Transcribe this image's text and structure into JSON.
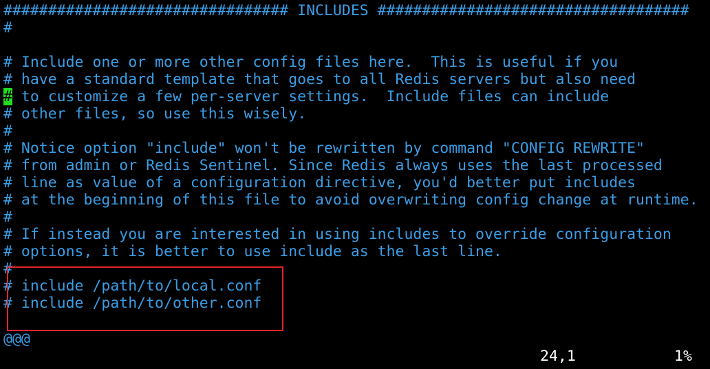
{
  "editor": {
    "lines": [
      "################################ INCLUDES ###################################",
      "#",
      "",
      "# Include one or more other config files here.  This is useful if you",
      "# have a standard template that goes to all Redis servers but also need",
      "# to customize a few per-server settings.  Include files can include",
      "# other files, so use this wisely.",
      "#",
      "# Notice option \"include\" won't be rewritten by command \"CONFIG REWRITE\"",
      "# from admin or Redis Sentinel. Since Redis always uses the last processed",
      "# line as value of a configuration directive, you'd better put includes",
      "# at the beginning of this file to avoid overwriting config change at runtime.",
      "#",
      "# If instead you are interested in using includes to override configuration",
      "# options, it is better to use include as the last line.",
      "#",
      "# include /path/to/local.conf",
      "# include /path/to/other.conf"
    ],
    "cursor_char": "#",
    "line_6_rest": " to customize a few per-server settings.  Include files can include",
    "truncation_marker": "@@@"
  },
  "status": {
    "position": "24,1",
    "percent": "1%"
  },
  "colors": {
    "background": "#000000",
    "comment_text": "#3a9ee6",
    "cursor_bg": "#22dd22",
    "status_text": "#ffffff",
    "annotation_box": "#e0252b"
  }
}
